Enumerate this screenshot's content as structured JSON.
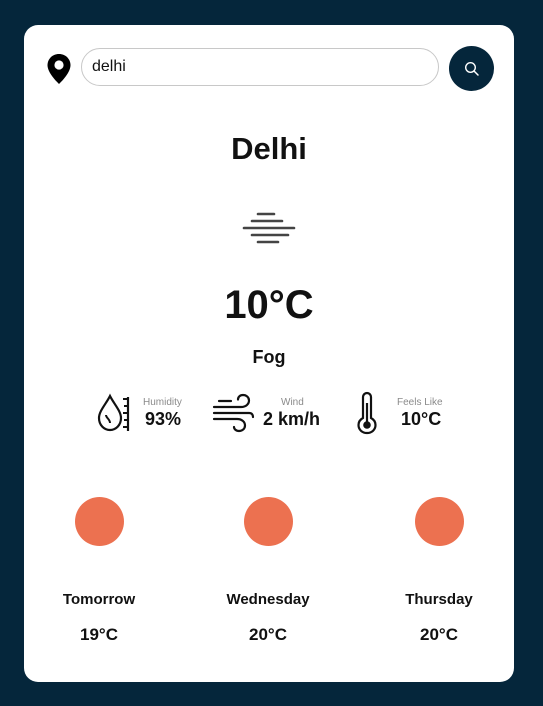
{
  "search": {
    "value": "delhi",
    "placeholder": "",
    "button_icon": "search-icon"
  },
  "location_icon": "map-pin-icon",
  "current": {
    "city": "Delhi",
    "condition_icon": "fog-icon",
    "temperature": "10°C",
    "description": "Fog"
  },
  "stats": {
    "humidity": {
      "label": "Humidity",
      "value": "93%",
      "icon": "humidity-icon"
    },
    "wind": {
      "label": "Wind",
      "value": "2 km/h",
      "icon": "wind-icon"
    },
    "feels_like": {
      "label": "Feels Like",
      "value": "10°C",
      "icon": "thermometer-icon"
    }
  },
  "forecast": [
    {
      "day": "Tomorrow",
      "temp": "19°C"
    },
    {
      "day": "Wednesday",
      "temp": "20°C"
    },
    {
      "day": "Thursday",
      "temp": "20°C"
    }
  ],
  "colors": {
    "background": "#05263b",
    "card": "#ffffff",
    "accent": "#05263b",
    "forecast_dot": "#ec7150"
  }
}
